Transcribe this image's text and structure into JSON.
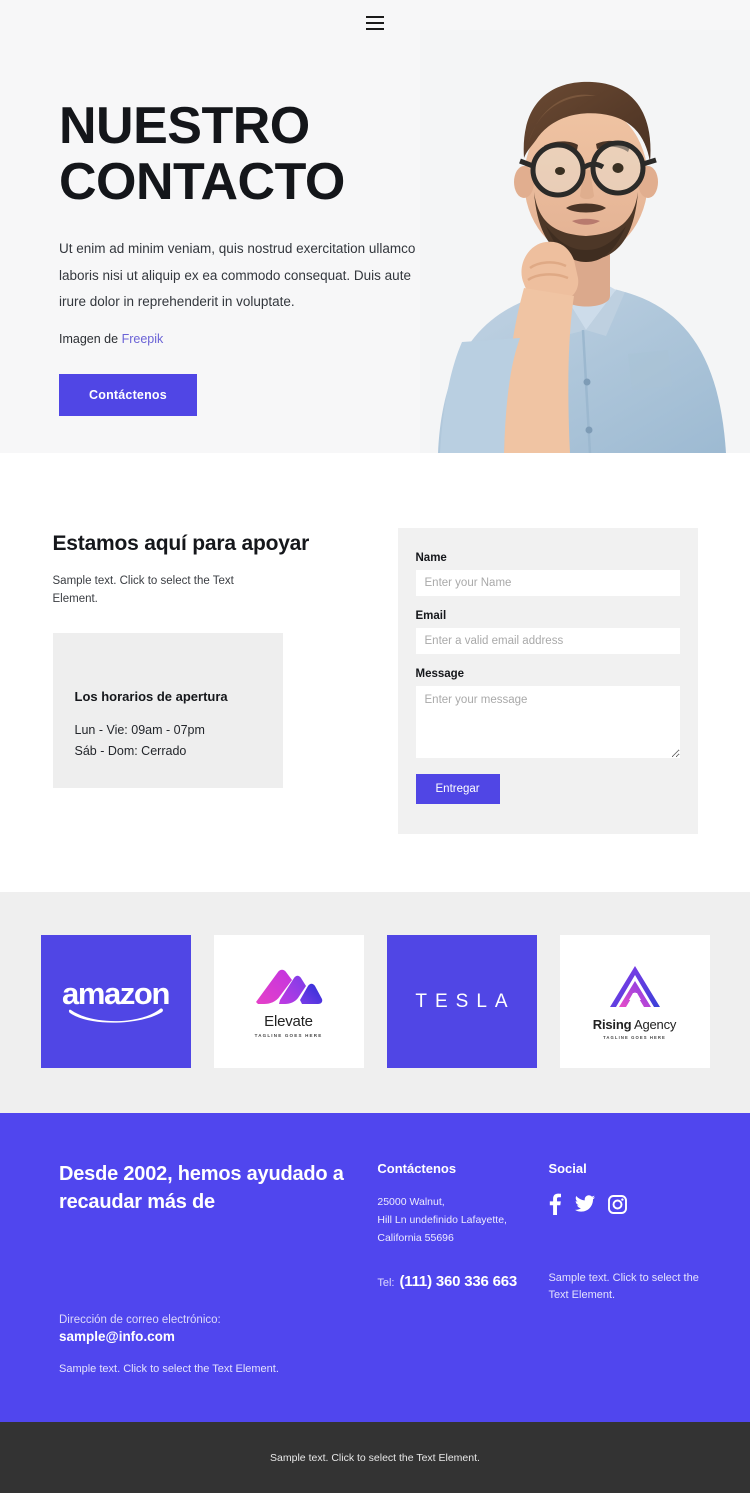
{
  "nav": {
    "menu_icon": "hamburger-menu-icon"
  },
  "hero": {
    "title_line1": "NUESTRO",
    "title_line2": "CONTACTO",
    "description": "Ut enim ad minim veniam, quis nostrud exercitation ullamco laboris nisi ut aliquip ex ea commodo consequat. Duis aute irure dolor in reprehenderit in voluptate.",
    "credit_prefix": "Imagen de",
    "credit_link": "Freepik",
    "cta_label": "Contáctenos",
    "photo_alt": "man-with-glasses-thinking-photo",
    "background_color": "#f7f7f8",
    "accent_color": "#5046e5"
  },
  "contact": {
    "heading": "Estamos aquí para apoyar",
    "subtext": "Sample text. Click to select the Text Element.",
    "hours": {
      "title": "Los horarios de apertura",
      "lines": [
        "Lun - Vie: 09am - 07pm",
        "Sáb - Dom: Cerrado"
      ],
      "background_color": "#eeeeee"
    },
    "form": {
      "background_color": "#f1f1f1",
      "fields": [
        {
          "label": "Name",
          "placeholder": "Enter your Name",
          "value": "",
          "type": "text"
        },
        {
          "label": "Email",
          "placeholder": "Enter a valid email address",
          "value": "",
          "type": "email"
        },
        {
          "label": "Message",
          "placeholder": "Enter your message",
          "value": "",
          "type": "textarea"
        }
      ],
      "submit_label": "Entregar"
    }
  },
  "logos": {
    "background_color": "#efefef",
    "items": [
      {
        "name": "amazon",
        "label": "amazon",
        "tagline": "",
        "style": "purple"
      },
      {
        "name": "elevate",
        "label": "Elevate",
        "tagline": "TAGLINE GOES HERE",
        "style": "white"
      },
      {
        "name": "tesla",
        "label": "TESLA",
        "tagline": "",
        "style": "purple"
      },
      {
        "name": "rising-agency",
        "label_bold": "Rising",
        "label_rest": "Agency",
        "tagline": "TAGLINE GOES HERE",
        "style": "white"
      }
    ]
  },
  "footer": {
    "background_color": "#5046ee",
    "heading": "Desde 2002, hemos ayudado a recaudar más de",
    "email_label": "Dirección de correo electrónico:",
    "email": "sample@info.com",
    "note": "Sample text. Click to select the Text Element.",
    "contact_title": "Contáctenos",
    "address_lines": [
      "25000 Walnut,",
      "Hill Ln undefinido Lafayette,",
      "California 55696"
    ],
    "tel_label": "Tel:",
    "tel_value": "(111) 360 336 663",
    "social_title": "Social",
    "social_icons": [
      "facebook-icon",
      "twitter-icon",
      "instagram-icon"
    ],
    "social_note": "Sample text. Click to select the Text Element."
  },
  "bottombar": {
    "background_color": "#333333",
    "text": "Sample text. Click to select the Text Element."
  }
}
